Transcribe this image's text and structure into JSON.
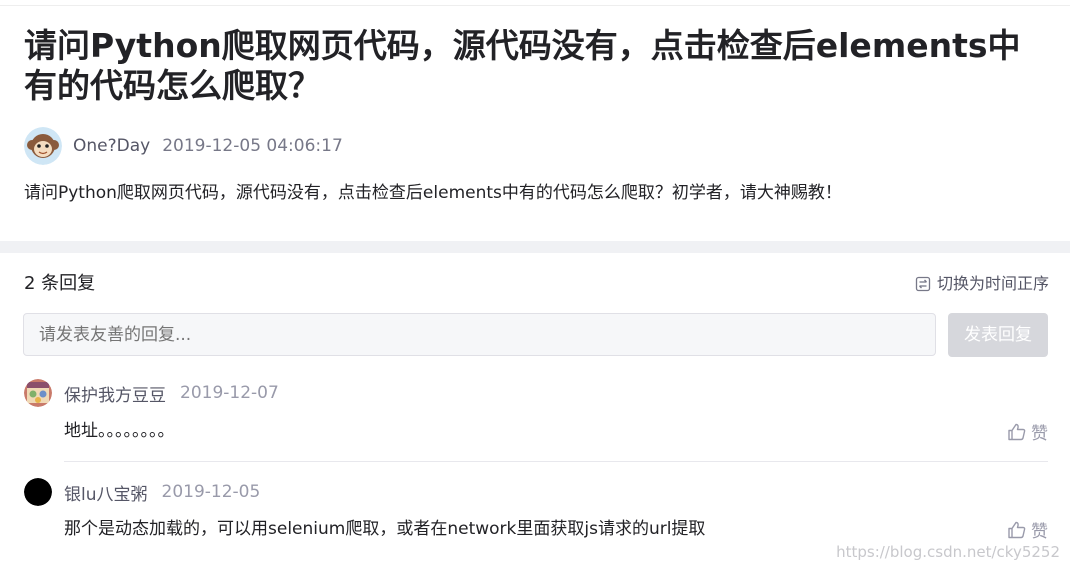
{
  "post": {
    "title": "请问Python爬取网页代码，源代码没有，点击检查后elements中有的代码怎么爬取？",
    "author": "One?Day",
    "time": "2019-12-05 04:06:17",
    "body": "请问Python爬取网页代码，源代码没有，点击检查后elements中有的代码怎么爬取？初学者，请大神赐教！",
    "avatar_icon": "monkey-avatar-icon"
  },
  "replies_section": {
    "count_label": "2 条回复",
    "sort_label": "切换为时间正序",
    "sort_icon": "sort-icon",
    "input_placeholder": "请发表友善的回复...",
    "submit_label": "发表回复"
  },
  "replies": [
    {
      "name": "保护我方豆豆",
      "time": "2019-12-07",
      "content": "地址。。。。。。。。",
      "like_label": "赞",
      "avatar_icon": "anime-avatar-icon"
    },
    {
      "name": "银lu八宝粥",
      "time": "2019-12-05",
      "content": "那个是动态加载的，可以用selenium爬取，或者在network里面获取js请求的url提取",
      "like_label": "赞",
      "avatar_icon": "black-circle-avatar-icon"
    }
  ],
  "watermark": "https://blog.csdn.net/cky5252",
  "colors": {
    "title": "#222226",
    "meta": "#777888",
    "band": "#f0f1f4",
    "button_disabled": "#d6d7dc"
  }
}
